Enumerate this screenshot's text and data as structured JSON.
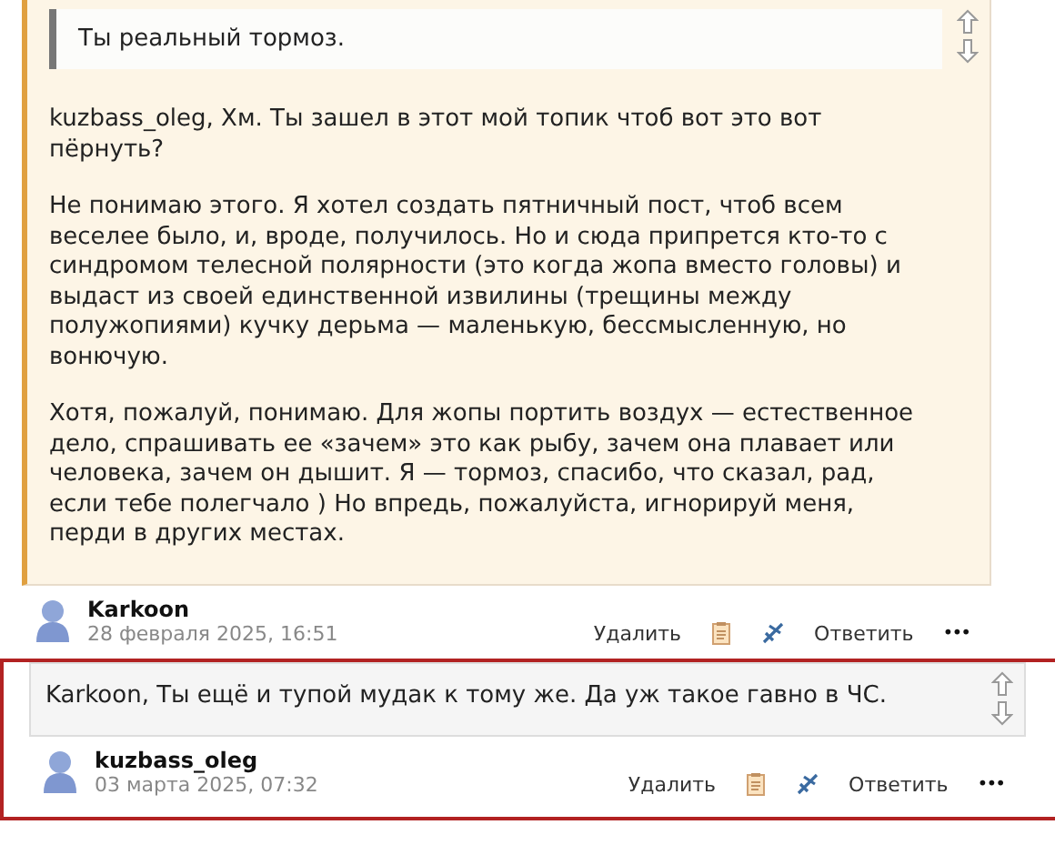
{
  "comments": [
    {
      "kind": "tinted",
      "highlighted": false,
      "quote": "Ты реальный тормоз.",
      "paragraphs": [
        "kuzbass_oleg, Хм. Ты зашел в этот мой топик чтоб вот это вот пёрнуть?",
        "Не понимаю этого. Я хотел создать пятничный пост, чтоб всем веселее было, и, вроде, получилось. Но и сюда припрется кто-то с синдромом телесной полярности (это когда жопа вместо головы) и выдаст из своей единственной извилины (трещины между полужопиями) кучку дерьма — маленькую, бессмысленную, но вонючую.",
        "Хотя, пожалуй, понимаю. Для жопы портить воздух — естественное дело, спрашивать ее «зачем» это как рыбу, зачем она плавает или человека, зачем он дышит. Я — тормоз, спасибо, что сказал, рад, если тебе полегчало ) Но впредь, пожалуйста, игнорируй меня, перди в других местах."
      ],
      "author": "Karkoon",
      "date": "28 февраля 2025, 16:51",
      "actions": {
        "delete": "Удалить",
        "reply": "Ответить",
        "more": "•••"
      }
    },
    {
      "kind": "plain",
      "highlighted": true,
      "text": "Karkoon, Ты ещё и тупой мудак к тому же. Да уж такое гавно в ЧС.",
      "author": "kuzbass_oleg",
      "date": "03 марта 2025, 07:32",
      "actions": {
        "delete": "Удалить",
        "reply": "Ответить",
        "more": "•••"
      }
    }
  ]
}
